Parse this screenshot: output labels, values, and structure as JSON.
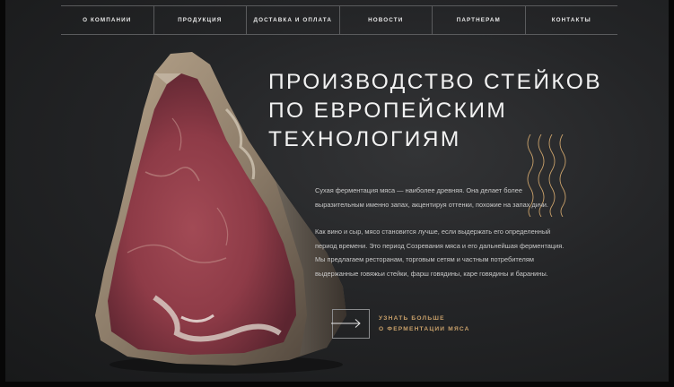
{
  "nav": {
    "items": [
      "О КОМПАНИИ",
      "ПРОДУКЦИЯ",
      "ДОСТАВКА И ОПЛАТА",
      "НОВОСТИ",
      "ПАРТНЕРАМ",
      "КОНТАКТЫ"
    ]
  },
  "hero": {
    "title_lines": [
      "ПРОИЗВОДСТВО СТЕЙКОВ",
      "ПО ЕВРОПЕЙСКИМ",
      "ТЕХНОЛОГИЯМ"
    ],
    "paragraph1_lines": [
      "Сухая ферментация мяса — наиболее древняя. Она делает более",
      "выразительным именно запах, акцентируя оттенки, похожие на запах дичи."
    ],
    "paragraph2_lines": [
      "Как вино и сыр, мясо становится лучше, если выдержать его определенный",
      "период времени. Это период Созревания мяса и его дальнейшая ферментация.",
      "Мы предлагаем ресторанам, торговым сетям и частным потребителям",
      "выдержанные говяжьи стейки, фарш говядины, каре говядины и баранины."
    ],
    "cta_lines": [
      "УЗНАТЬ БОЛЬШЕ",
      "О ФЕРМЕНТАЦИИ МЯСА"
    ]
  },
  "colors": {
    "background": "#242527",
    "accent": "#c8a06a",
    "nav_border": "#5a5b5d"
  }
}
